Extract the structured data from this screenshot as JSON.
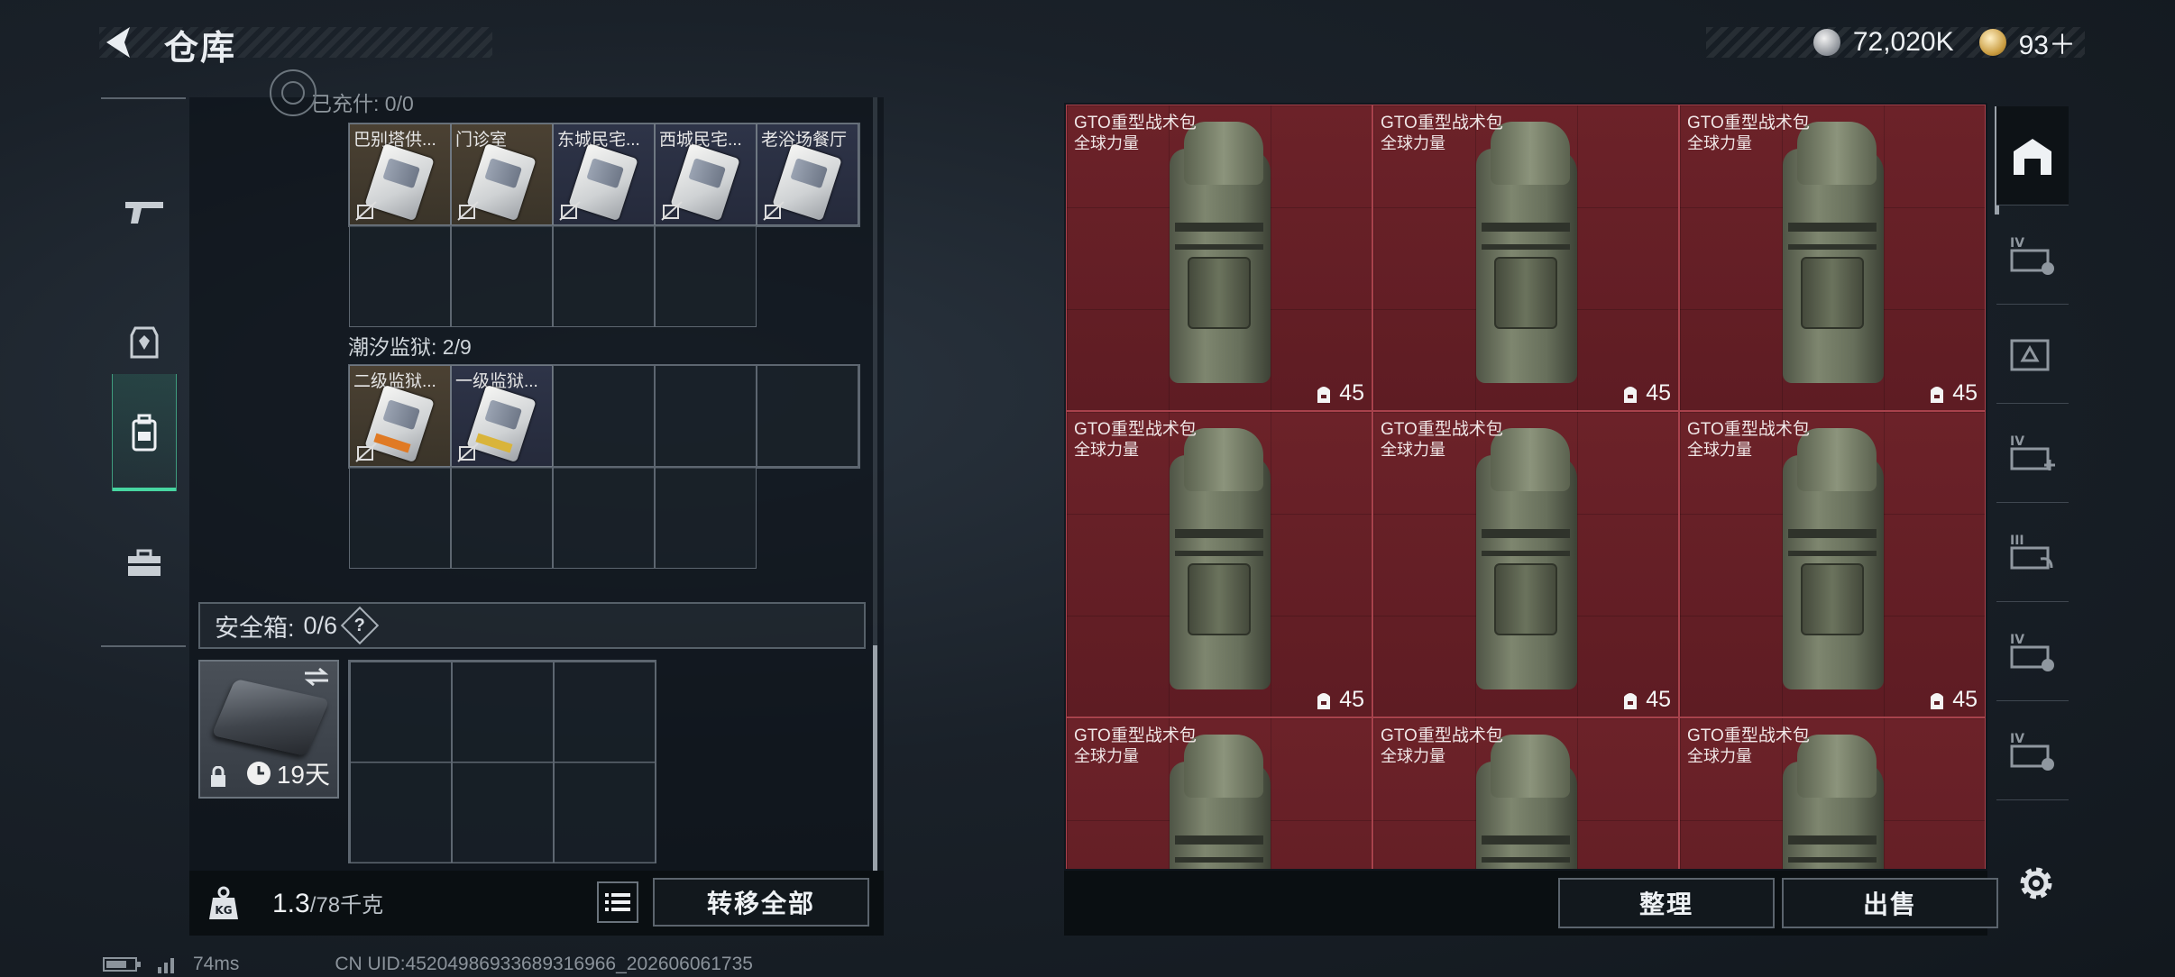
{
  "header": {
    "title": "仓库",
    "currency_silver": "72,020K",
    "currency_gold": "93＋"
  },
  "left_panel": {
    "top_partial_label": "已充什: 0/0",
    "keys_row1": [
      "巴别塔供...",
      "门诊室",
      "东城民宅...",
      "西城民宅...",
      "老浴场餐厅"
    ],
    "prison_label": "潮汐监狱: 2/9",
    "keys_prison": [
      "二级监狱...",
      "一级监狱..."
    ],
    "safe_label": "安全箱:",
    "safe_count": "0/6",
    "safe_help": "?",
    "safebox_days": "19天",
    "weight_value": "1.3",
    "weight_max": "/78千克",
    "transfer_all": "转移全部"
  },
  "items": {
    "bag_name": "GTO重型战术包",
    "bag_sub": "全球力量",
    "bag_capacity": "45",
    "cells": [
      {
        "name": "GTO重型战术包",
        "sub": "全球力量",
        "cap": "45"
      },
      {
        "name": "GTO重型战术包",
        "sub": "全球力量",
        "cap": "45"
      },
      {
        "name": "GTO重型战术包",
        "sub": "全球力量",
        "cap": "45"
      },
      {
        "name": "GTO重型战术包",
        "sub": "全球力量",
        "cap": "45"
      },
      {
        "name": "GTO重型战术包",
        "sub": "全球力量",
        "cap": "45"
      },
      {
        "name": "GTO重型战术包",
        "sub": "全球力量",
        "cap": "45"
      },
      {
        "name": "GTO重型战术包",
        "sub": "全球力量",
        "cap": ""
      },
      {
        "name": "GTO重型战术包",
        "sub": "全球力量",
        "cap": ""
      },
      {
        "name": "GTO重型战术包",
        "sub": "全球力量",
        "cap": ""
      }
    ]
  },
  "actions": {
    "organize": "整理",
    "sell": "出售"
  },
  "right_nav": [
    "IV",
    "",
    "IV",
    "III",
    "IV",
    "IV"
  ],
  "footer": {
    "ping": "74ms",
    "uid": "CN UID:45204986933689316966_202606061735"
  },
  "colors": {
    "accent": "#47d6a1",
    "item_bg": "#6c2229",
    "item_border": "#a8424c"
  }
}
